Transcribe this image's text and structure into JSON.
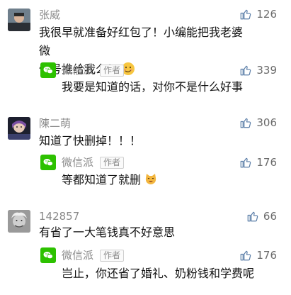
{
  "comments": [
    {
      "username": "张威",
      "likes": "126",
      "text_line1": "我很早就准备好红包了！小编能把我老婆微",
      "text_line2": "信号推给我么？",
      "emoji": "smirk-emoji",
      "reply": {
        "name": "微信派",
        "badge": "作者",
        "likes": "339",
        "text": "我要是知道的话，对你不是什么好事"
      }
    },
    {
      "username": "陳二萌",
      "likes": "306",
      "text": "知道了快删掉！！！",
      "reply": {
        "name": "微信派",
        "badge": "作者",
        "likes": "176",
        "text": "等都知道了就删",
        "emoji": "cat-emoji"
      }
    },
    {
      "username": "142857",
      "likes": "66",
      "text": "有省了一大笔钱真不好意思",
      "reply": {
        "name": "微信派",
        "badge": "作者",
        "likes": "176",
        "text": "岂止，你还省了婚礼、奶粉钱和学费呢"
      }
    }
  ],
  "colors": {
    "wechat_green": "#2dc100",
    "muted": "#8a8a8a"
  }
}
